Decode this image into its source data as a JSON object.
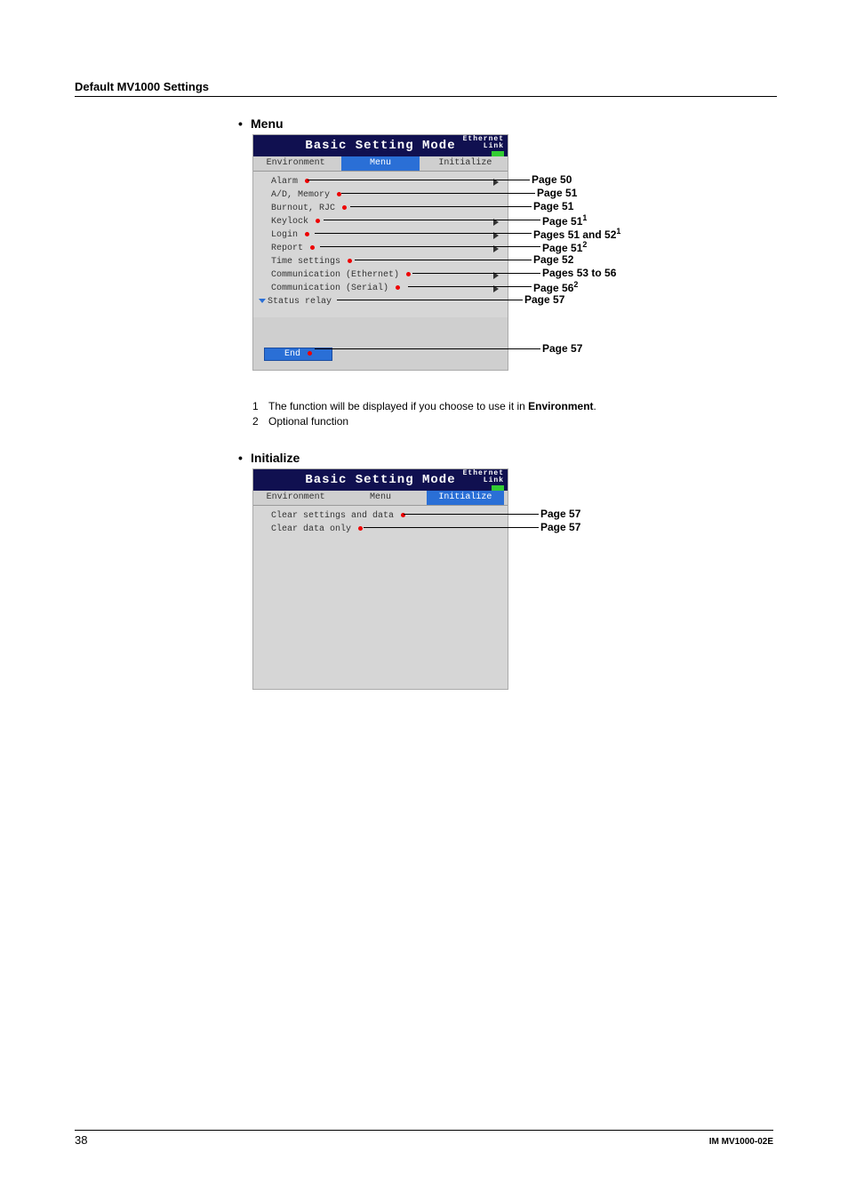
{
  "header": "Default MV1000 Settings",
  "section_menu": {
    "bullet": "Menu",
    "title": "Basic Setting Mode",
    "ethernet_label": "Ethernet\nLink",
    "tabs": [
      "Environment",
      "Menu",
      "Initialize"
    ],
    "active_tab": 1,
    "items": [
      {
        "label": "Alarm",
        "arrow": true
      },
      {
        "label": "A/D, Memory",
        "arrow": false
      },
      {
        "label": "Burnout, RJC",
        "arrow": false
      },
      {
        "label": "Keylock",
        "arrow": true
      },
      {
        "label": "Login",
        "arrow": true
      },
      {
        "label": "Report",
        "arrow": true
      },
      {
        "label": "Time settings",
        "arrow": false
      },
      {
        "label": "Communication (Ethernet)",
        "arrow": true
      },
      {
        "label": "Communication (Serial)",
        "arrow": true
      }
    ],
    "status_label": "Status relay",
    "end_label": "End",
    "callouts": [
      {
        "text": "Page 50",
        "sup": ""
      },
      {
        "text": "Page 51",
        "sup": ""
      },
      {
        "text": "Page 51",
        "sup": ""
      },
      {
        "text": "Page 51",
        "sup": "1"
      },
      {
        "text": "Pages 51 and 52",
        "sup": "1"
      },
      {
        "text": "Page 51",
        "sup": "2"
      },
      {
        "text": "Page 52",
        "sup": ""
      },
      {
        "text": "Pages 53 to 56",
        "sup": ""
      },
      {
        "text": "Page 56",
        "sup": "2"
      },
      {
        "text": "Page 57",
        "sup": ""
      }
    ],
    "end_callout": "Page 57"
  },
  "footnotes": [
    {
      "num": "1",
      "text_a": "The function will be displayed if you choose to use it in ",
      "bold": "Environment",
      "text_b": "."
    },
    {
      "num": "2",
      "text_a": "Optional function",
      "bold": "",
      "text_b": ""
    }
  ],
  "section_init": {
    "bullet": "Initialize",
    "title": "Basic Setting Mode",
    "ethernet_label": "Ethernet\nLink",
    "tabs": [
      "Environment",
      "Menu",
      "Initialize"
    ],
    "active_tab": 2,
    "items": [
      {
        "label": "Clear settings and data",
        "arrow": false
      },
      {
        "label": "Clear data only",
        "arrow": false
      }
    ],
    "callouts": [
      {
        "text": "Page 57",
        "sup": ""
      },
      {
        "text": "Page 57",
        "sup": ""
      }
    ]
  },
  "page_number": "38",
  "doc_code": "IM MV1000-02E"
}
